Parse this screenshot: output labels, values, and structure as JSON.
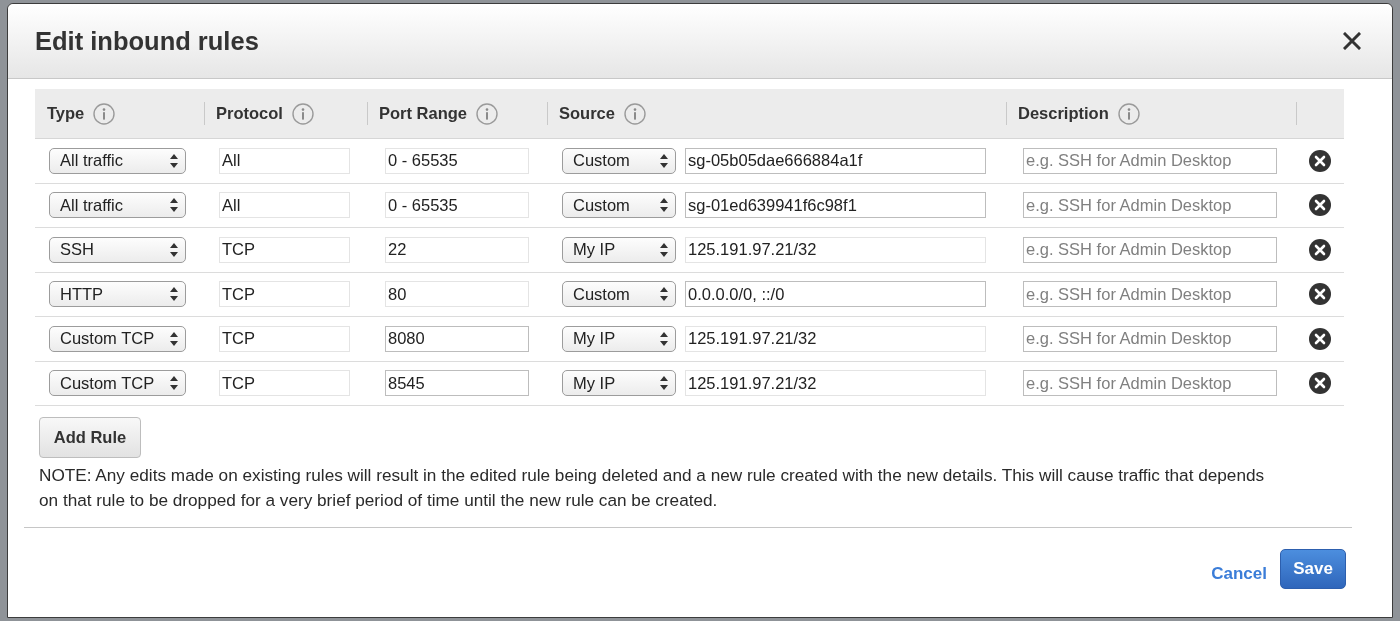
{
  "dialog": {
    "title": "Edit inbound rules"
  },
  "table": {
    "columns": [
      {
        "label": "Type"
      },
      {
        "label": "Protocol"
      },
      {
        "label": "Port Range"
      },
      {
        "label": "Source"
      },
      {
        "label": "Description"
      }
    ],
    "rows": [
      {
        "type": "All traffic",
        "protocol": {
          "value": "All",
          "disabled": true
        },
        "port_range": {
          "value": "0 - 65535",
          "disabled": true
        },
        "source_type": "Custom",
        "source": {
          "value": "sg-05b05dae666884a1f",
          "disabled": false
        },
        "description": {
          "placeholder": "e.g. SSH for Admin Desktop"
        }
      },
      {
        "type": "All traffic",
        "protocol": {
          "value": "All",
          "disabled": true
        },
        "port_range": {
          "value": "0 - 65535",
          "disabled": true
        },
        "source_type": "Custom",
        "source": {
          "value": "sg-01ed639941f6c98f1",
          "disabled": false
        },
        "description": {
          "placeholder": "e.g. SSH for Admin Desktop"
        }
      },
      {
        "type": "SSH",
        "protocol": {
          "value": "TCP",
          "disabled": true
        },
        "port_range": {
          "value": "22",
          "disabled": true
        },
        "source_type": "My IP",
        "source": {
          "value": "125.191.97.21/32",
          "disabled": true
        },
        "description": {
          "placeholder": "e.g. SSH for Admin Desktop"
        }
      },
      {
        "type": "HTTP",
        "protocol": {
          "value": "TCP",
          "disabled": true
        },
        "port_range": {
          "value": "80",
          "disabled": true
        },
        "source_type": "Custom",
        "source": {
          "value": "0.0.0.0/0, ::/0",
          "disabled": false
        },
        "description": {
          "placeholder": "e.g. SSH for Admin Desktop"
        }
      },
      {
        "type": "Custom TCP",
        "protocol": {
          "value": "TCP",
          "disabled": true
        },
        "port_range": {
          "value": "8080",
          "disabled": false
        },
        "source_type": "My IP",
        "source": {
          "value": "125.191.97.21/32",
          "disabled": true
        },
        "description": {
          "placeholder": "e.g. SSH for Admin Desktop"
        }
      },
      {
        "type": "Custom TCP",
        "protocol": {
          "value": "TCP",
          "disabled": true
        },
        "port_range": {
          "value": "8545",
          "disabled": false
        },
        "source_type": "My IP",
        "source": {
          "value": "125.191.97.21/32",
          "disabled": true
        },
        "description": {
          "placeholder": "e.g. SSH for Admin Desktop"
        }
      }
    ]
  },
  "add_button": "Add Rule",
  "note": "NOTE: Any edits made on existing rules will result in the edited rule being deleted and a new rule created with the new details. This will cause traffic that depends on that rule to be dropped for a very brief period of time until the new rule can be created.",
  "footer": {
    "cancel": "Cancel",
    "save": "Save"
  }
}
